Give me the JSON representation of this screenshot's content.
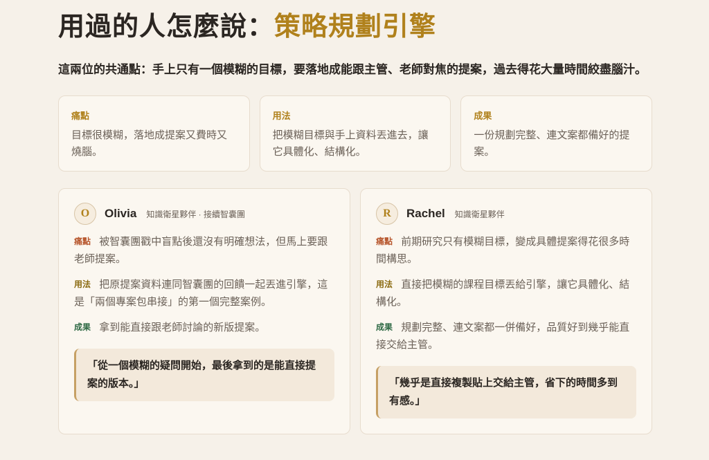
{
  "header": {
    "title_prefix": "用過的人怎麼說：",
    "title_accent": "策略規劃引擎",
    "subtitle": "這兩位的共通點：手上只有一個模糊的目標，要落地成能跟主管、老師對焦的提案，過去得花大量時間絞盡腦汁。"
  },
  "summary": [
    {
      "label": "痛點",
      "text": "目標很模糊，落地成提案又費時又燒腦。"
    },
    {
      "label": "用法",
      "text": "把模糊目標與手上資料丟進去，讓它具體化、結構化。"
    },
    {
      "label": "成果",
      "text": "一份規劃完整、連文案都備好的提案。"
    }
  ],
  "testimonials": [
    {
      "initial": "O",
      "name": "Olivia",
      "meta": "知識衛星夥伴 · 接續智囊團",
      "pain_label": "痛點",
      "pain": "被智囊團戳中盲點後還沒有明確想法，但馬上要跟老師提案。",
      "use_label": "用法",
      "use": "把原提案資料連同智囊團的回饋一起丟進引擎，這是「兩個專案包串接」的第一個完整案例。",
      "result_label": "成果",
      "result": "拿到能直接跟老師討論的新版提案。",
      "quote": "「從一個模糊的疑問開始，最後拿到的是能直接提案的版本。」"
    },
    {
      "initial": "R",
      "name": "Rachel",
      "meta": "知識衛星夥伴",
      "pain_label": "痛點",
      "pain": "前期研究只有模糊目標，變成具體提案得花很多時間構思。",
      "use_label": "用法",
      "use": "直接把模糊的課程目標丟給引擎，讓它具體化、結構化。",
      "result_label": "成果",
      "result": "規劃完整、連文案都一併備好，品質好到幾乎能直接交給主管。",
      "quote": "「幾乎是直接複製貼上交給主管，省下的時間多到有感。」"
    }
  ]
}
